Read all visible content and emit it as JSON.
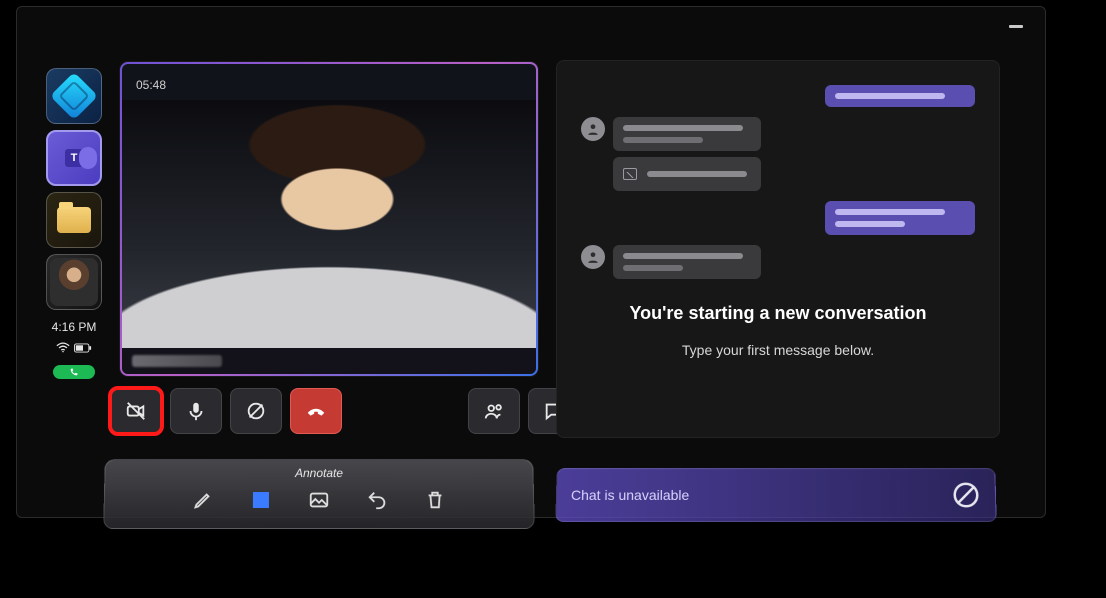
{
  "window": {
    "minimize": "—"
  },
  "sidebar": {
    "items": [
      {
        "name": "logo"
      },
      {
        "name": "teams",
        "badge": "T"
      },
      {
        "name": "folder"
      },
      {
        "name": "avatar"
      }
    ],
    "clock": "4:16 PM"
  },
  "video": {
    "timer": "05:48",
    "caller_name_redacted": true
  },
  "controls": [
    "camera-off",
    "microphone",
    "share-off",
    "hangup",
    "participants",
    "chat"
  ],
  "chat_panel": {
    "title": "You're starting a new conversation",
    "subtitle": "Type your first message below."
  },
  "annotate": {
    "label": "Annotate",
    "tools": [
      "pen",
      "square",
      "image",
      "undo",
      "delete"
    ],
    "active_tool": "square"
  },
  "chat_bar": {
    "text": "Chat is unavailable"
  }
}
